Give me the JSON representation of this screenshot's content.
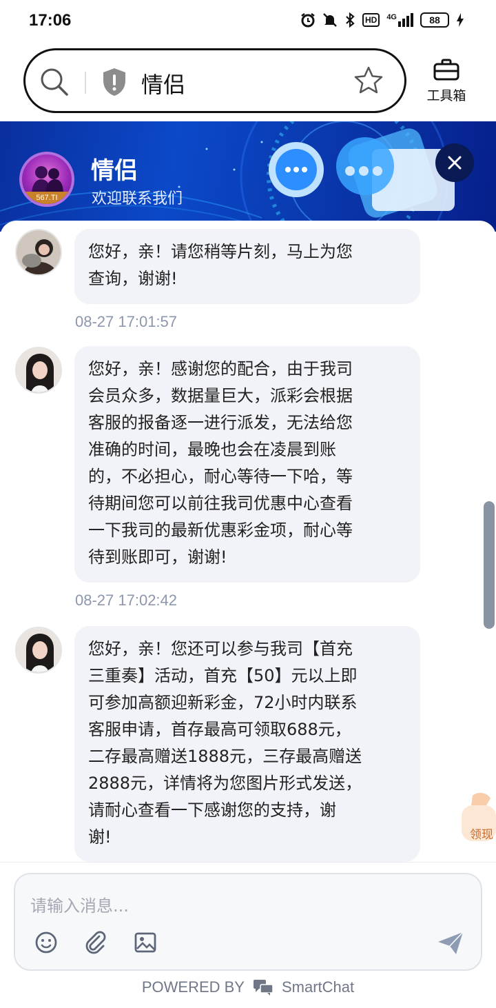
{
  "status_bar": {
    "time": "17:06",
    "network": "4G",
    "hd_badge": "HD",
    "battery": "88"
  },
  "search": {
    "query": "情侣",
    "toolbox_label": "工具箱"
  },
  "banner": {
    "title": "情侣",
    "subtitle": "欢迎联系我们",
    "avatar_text": "567.TI"
  },
  "messages": [
    {
      "text": "您好，亲！请您稍等片刻，马上为您\n查询，谢谢!",
      "time": "08-27 17:01:57"
    },
    {
      "text": "您好，亲！感谢您的配合，由于我司\n会员众多，数据量巨大，派彩会根据\n客服的报备逐一进行派发，无法给您\n准确的时间，最晚也会在凌晨到账\n的，不必担心，耐心等待一下哈，等\n待期间您可以前往我司优惠中心查看\n一下我司的最新优惠彩金项，耐心等\n待到账即可，谢谢!",
      "time": "08-27 17:02:42"
    },
    {
      "text": "您好，亲！您还可以参与我司【首充\n三重奏】活动，首充【50】元以上即\n可参加高额迎新彩金，72小时内联系\n客服申请，首存最高可领取688元，\n二存最高赠送1888元，三存最高赠送\n2888元，详情将为您图片形式发送，\n请耐心查看一下感谢您的支持，谢\n谢!"
    }
  ],
  "float_badge_label": "领现",
  "composer": {
    "placeholder": "请输入消息..."
  },
  "footer": {
    "powered_by": "POWERED BY",
    "brand": "SmartChat"
  },
  "colors": {
    "banner": "#0b49c9",
    "bubble": "#f2f3f8",
    "timestamp": "#8c96ad",
    "send": "#8e9cb3"
  }
}
